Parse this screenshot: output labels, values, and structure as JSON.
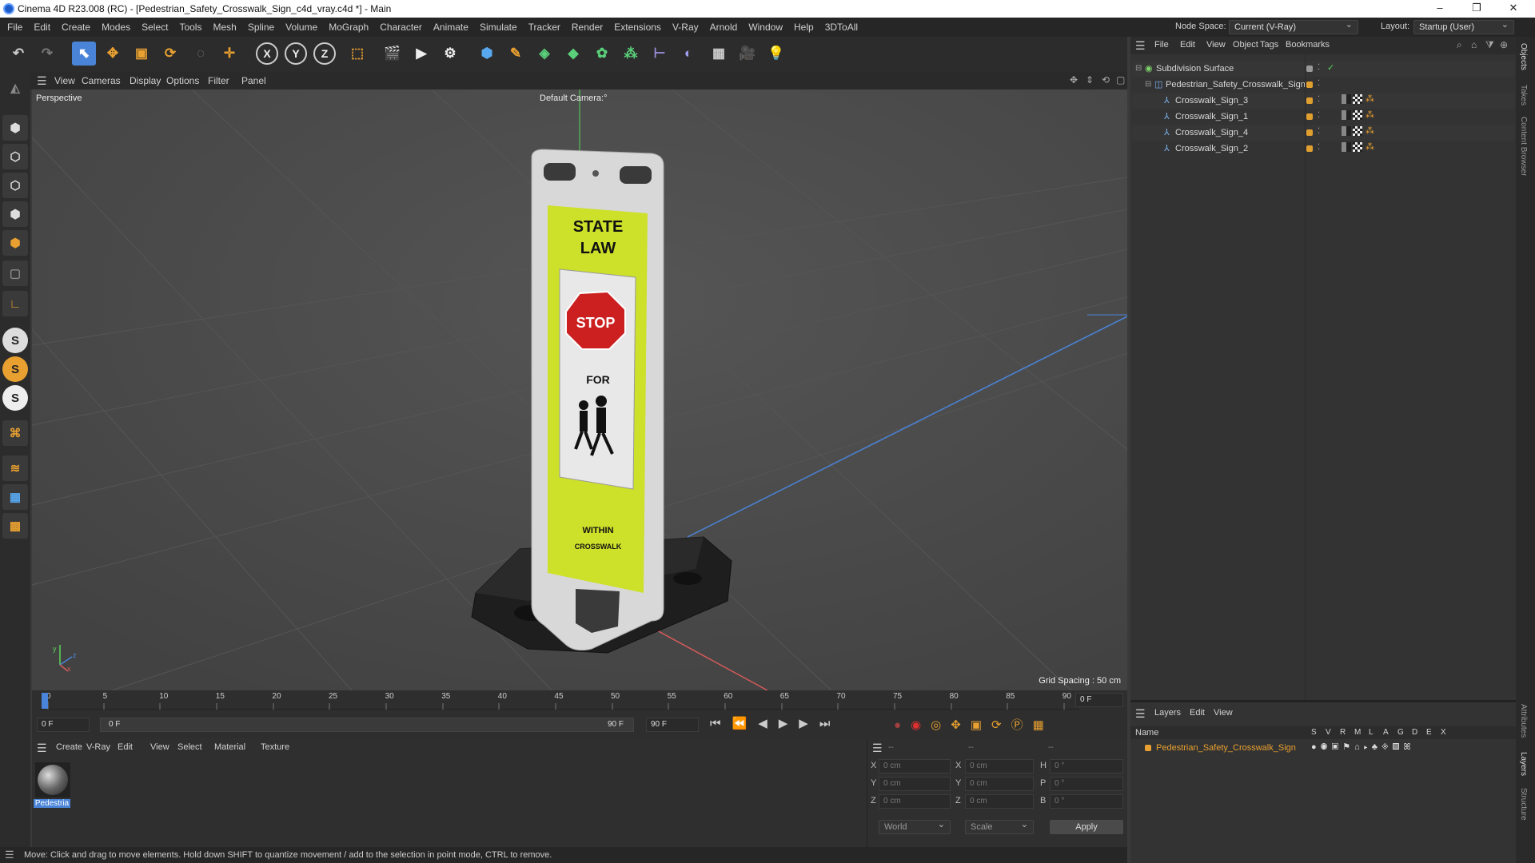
{
  "window": {
    "title": "Cinema 4D R23.008 (RC) - [Pedestrian_Safety_Crosswalk_Sign_c4d_vray.c4d *] - Main",
    "minimize": "–",
    "maximize": "❐",
    "close": "✕"
  },
  "menubar": {
    "items": [
      "File",
      "Edit",
      "Create",
      "Modes",
      "Select",
      "Tools",
      "Mesh",
      "Spline",
      "Volume",
      "MoGraph",
      "Character",
      "Animate",
      "Simulate",
      "Tracker",
      "Render",
      "Extensions",
      "V-Ray",
      "Arnold",
      "Window",
      "Help",
      "3DToAll"
    ],
    "node_space_label": "Node Space:",
    "node_space_value": "Current (V-Ray)",
    "layout_label": "Layout:",
    "layout_value": "Startup (User)"
  },
  "toolbar": {
    "icons": [
      "undo-icon",
      "redo-icon",
      "select-icon",
      "move-icon",
      "scale-icon",
      "rotate-icon",
      "live-select-icon",
      "place-icon",
      "x-axis-icon",
      "y-axis-icon",
      "z-axis-icon",
      "coordinate-system-icon",
      "render-view-icon",
      "render-icon",
      "render-settings-icon",
      "cube-icon",
      "pen-icon",
      "subdivision-icon",
      "extrude-icon",
      "cloner-icon",
      "mograph-icon",
      "symmetry-icon",
      "deformer-icon",
      "floor-icon",
      "camera-icon",
      "light-icon"
    ],
    "x_label": "X",
    "y_label": "Y",
    "z_label": "Z"
  },
  "lefttools": {
    "icons": [
      "model-mode-icon",
      "texture-mode-icon",
      "points-mode-icon",
      "edges-mode-icon",
      "polygons-mode-icon",
      "uvw-icon",
      "axis-icon",
      "snap-s-icon",
      "snap-s-orange-icon",
      "snap-s-white-icon",
      "magnet-icon",
      "workplane-icon",
      "grid-icon",
      "quantize-icon"
    ],
    "s_label": "S"
  },
  "viewport": {
    "menu": [
      "View",
      "Cameras",
      "Display",
      "Options",
      "Filter",
      "Panel"
    ],
    "label": "Perspective",
    "camera": "Default Camera",
    "camera_suffix": ":°",
    "grid_spacing": "Grid Spacing : 50 cm",
    "sign_lines": [
      "STATE",
      "LAW",
      "STOP",
      "FOR",
      "WITHIN",
      "CROSSWALK"
    ]
  },
  "timeline": {
    "ticks": [
      "0",
      "5",
      "10",
      "15",
      "20",
      "25",
      "30",
      "35",
      "40",
      "45",
      "50",
      "55",
      "60",
      "65",
      "70",
      "75",
      "80",
      "85",
      "90"
    ],
    "current_frame": "0 F",
    "start_frame": "0 F",
    "range_start": "0 F",
    "range_end": "90 F",
    "end_frame": "90 F"
  },
  "material_manager": {
    "menu": [
      "Create",
      "V-Ray",
      "Edit",
      "View",
      "Select",
      "Material",
      "Texture"
    ],
    "material_name": "Pedestria"
  },
  "coord_manager": {
    "headers": [
      "--",
      "--",
      "--"
    ],
    "rows": [
      {
        "a": "X",
        "av": "0 cm",
        "b": "X",
        "bv": "0 cm",
        "c": "H",
        "cv": "0 °"
      },
      {
        "a": "Y",
        "av": "0 cm",
        "b": "Y",
        "bv": "0 cm",
        "c": "P",
        "cv": "0 °"
      },
      {
        "a": "Z",
        "av": "0 cm",
        "b": "Z",
        "bv": "0 cm",
        "c": "B",
        "cv": "0 °"
      }
    ],
    "space": "World",
    "mode": "Scale",
    "apply": "Apply"
  },
  "status": "Move: Click and drag to move elements. Hold down SHIFT to quantize movement / add to the selection in point mode, CTRL to remove.",
  "object_manager": {
    "menu": [
      "File",
      "Edit",
      "View",
      "Object",
      "Tags",
      "Bookmarks"
    ],
    "objects": [
      {
        "name": "Subdivision Surface",
        "indent": 0,
        "color": "#7fd36b"
      },
      {
        "name": "Pedestrian_Safety_Crosswalk_Sign",
        "indent": 1,
        "color": "#e0a030"
      },
      {
        "name": "Crosswalk_Sign_3",
        "indent": 2,
        "color": "#e0a030"
      },
      {
        "name": "Crosswalk_Sign_1",
        "indent": 2,
        "color": "#e0a030"
      },
      {
        "name": "Crosswalk_Sign_4",
        "indent": 2,
        "color": "#e0a030"
      },
      {
        "name": "Crosswalk_Sign_2",
        "indent": 2,
        "color": "#e0a030"
      }
    ]
  },
  "layer_manager": {
    "menu": [
      "Layers",
      "Edit",
      "View"
    ],
    "name_header": "Name",
    "col_headers": [
      "S",
      "V",
      "R",
      "M",
      "L",
      "A",
      "G",
      "D",
      "E",
      "X"
    ],
    "layer_name": "Pedestrian_Safety_Crosswalk_Sign",
    "layer_color": "#e8a030"
  },
  "side_tabs": [
    "Objects",
    "Takes",
    "Content Browser",
    "Attributes",
    "Layers",
    "Structure"
  ],
  "colors": {
    "accent_blue": "#4a84d8",
    "x_axis": "#d65a5a",
    "y_axis": "#6ad65a",
    "z_axis": "#5a8ad6"
  }
}
